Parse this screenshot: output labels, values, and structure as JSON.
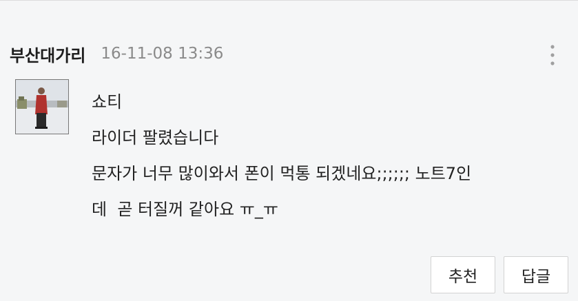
{
  "comment": {
    "author": "부산대가리",
    "date": "16-11-08 13:36",
    "more_icon": "more-vertical-icon",
    "avatar": "avatar",
    "lines": [
      "쇼티",
      "라이더 팔렸습니다",
      "문자가 너무 많이와서 폰이 먹통 되겠네요;;;;;; 노트7인",
      "데  곧 터질꺼 같아요 ㅠ_ㅠ"
    ],
    "actions": {
      "recommend_label": "추천",
      "reply_label": "답글"
    }
  },
  "colors": {
    "background": "#f5f6f7",
    "author": "#1e1e1e",
    "date": "#8a8a8a",
    "button_border": "#d2d2d2"
  }
}
